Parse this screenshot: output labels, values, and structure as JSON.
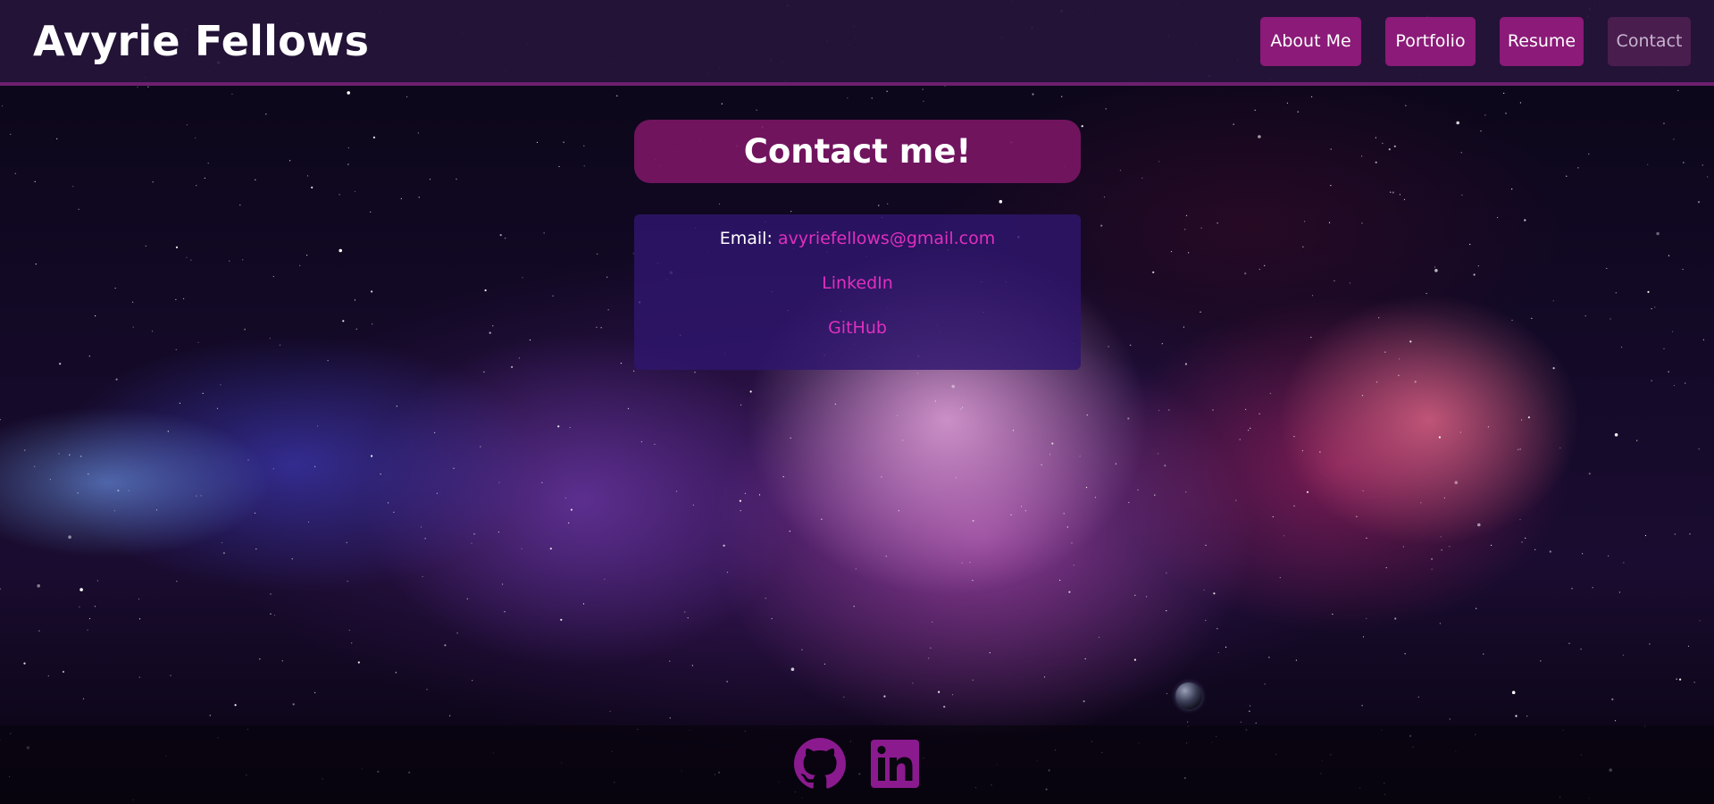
{
  "header": {
    "brand": "Avyrie Fellows",
    "nav": [
      {
        "label": "About Me",
        "active": false
      },
      {
        "label": "Portfolio",
        "active": false
      },
      {
        "label": "Resume",
        "active": false
      },
      {
        "label": "Contact",
        "active": true
      }
    ]
  },
  "contact": {
    "title": "Contact me!",
    "email_label": "Email:",
    "email": "avyriefellows@gmail.com",
    "linkedin": "LinkedIn",
    "github": "GitHub"
  },
  "footer": {
    "icons": [
      "github-icon",
      "linkedin-icon"
    ]
  },
  "colors": {
    "accent": "#8b1a78",
    "link": "#e02fbf",
    "header_bg": "#26143a",
    "active_nav": "#4a1d4f",
    "icon": "#8b1a8f"
  }
}
